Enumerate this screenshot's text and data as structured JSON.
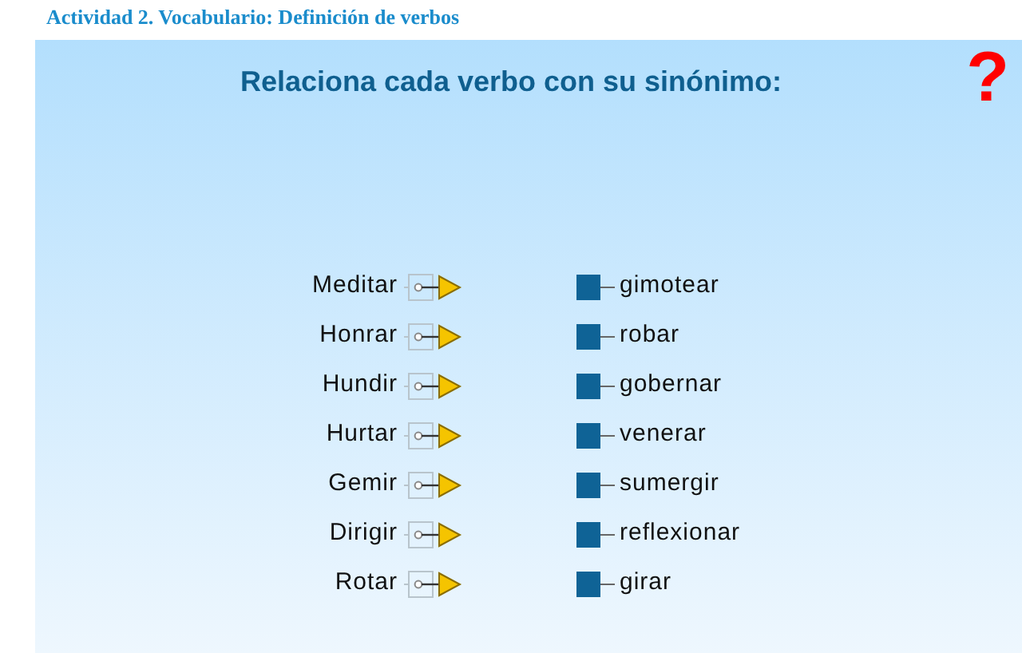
{
  "header": {
    "title": "Actividad 2. Vocabulario: Definición de verbos"
  },
  "activity": {
    "instruction": "Relaciona cada verbo con su sinónimo:",
    "help_mark": "?",
    "verbs": [
      "Meditar",
      "Honrar",
      "Hundir",
      "Hurtar",
      "Gemir",
      "Dirigir",
      "Rotar"
    ],
    "synonyms": [
      "gimotear",
      "robar",
      "gobernar",
      "venerar",
      "sumergir",
      "reflexionar",
      "girar"
    ]
  }
}
